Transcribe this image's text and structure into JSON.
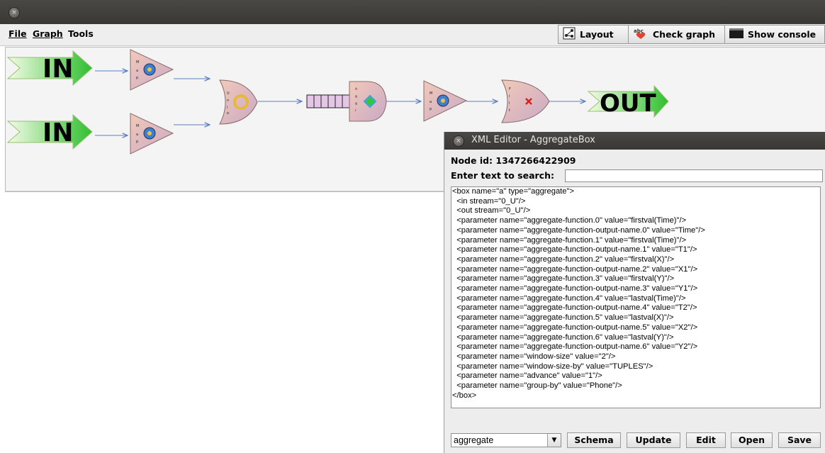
{
  "window": {
    "close_glyph": "×"
  },
  "menu": [
    {
      "label": "File",
      "mnemonic_index": 0
    },
    {
      "label": "Graph",
      "mnemonic_index": 0
    },
    {
      "label": "Tools",
      "mnemonic_index": -1
    }
  ],
  "toolbar": {
    "layout": {
      "label": "Layout",
      "icon": "layout-icon"
    },
    "check_graph": {
      "label": "Check graph",
      "icon": "spellcheck-icon"
    },
    "show_console": {
      "label": "Show console",
      "icon": "console-icon"
    }
  },
  "graph": {
    "in_label": "IN",
    "out_label": "OUT",
    "map_label": "Map",
    "union_label": "Union",
    "aggregate_label": "Aggregate",
    "filter_label": "Filter",
    "colors": {
      "arrow": "#5a7fc4",
      "box": "#e8b7a8",
      "in_green": "#3cc63c"
    }
  },
  "xml_editor": {
    "title": "XML Editor - AggregateBox",
    "node_id_label": "Node id: 1347266422909",
    "search_label": "Enter text to search:",
    "search_value": "",
    "content": "<box name=\"a\" type=\"aggregate\">\n  <in stream=\"0_U\"/>\n  <out stream=\"0_U\"/>\n  <parameter name=\"aggregate-function.0\" value=\"firstval(Time)\"/>\n  <parameter name=\"aggregate-function-output-name.0\" value=\"Time\"/>\n  <parameter name=\"aggregate-function.1\" value=\"firstval(Time)\"/>\n  <parameter name=\"aggregate-function-output-name.1\" value=\"T1\"/>\n  <parameter name=\"aggregate-function.2\" value=\"firstval(X)\"/>\n  <parameter name=\"aggregate-function-output-name.2\" value=\"X1\"/>\n  <parameter name=\"aggregate-function.3\" value=\"firstval(Y)\"/>\n  <parameter name=\"aggregate-function-output-name.3\" value=\"Y1\"/>\n  <parameter name=\"aggregate-function.4\" value=\"lastval(Time)\"/>\n  <parameter name=\"aggregate-function-output-name.4\" value=\"T2\"/>\n  <parameter name=\"aggregate-function.5\" value=\"lastval(X)\"/>\n  <parameter name=\"aggregate-function-output-name.5\" value=\"X2\"/>\n  <parameter name=\"aggregate-function.6\" value=\"lastval(Y)\"/>\n  <parameter name=\"aggregate-function-output-name.6\" value=\"Y2\"/>\n  <parameter name=\"window-size\" value=\"2\"/>\n  <parameter name=\"window-size-by\" value=\"TUPLES\"/>\n  <parameter name=\"advance\" value=\"1\"/>\n  <parameter name=\"group-by\" value=\"Phone\"/>\n</box>",
    "type_select": "aggregate",
    "buttons": {
      "schema": "Schema",
      "update": "Update",
      "edit": "Edit",
      "open": "Open",
      "save": "Save"
    }
  }
}
